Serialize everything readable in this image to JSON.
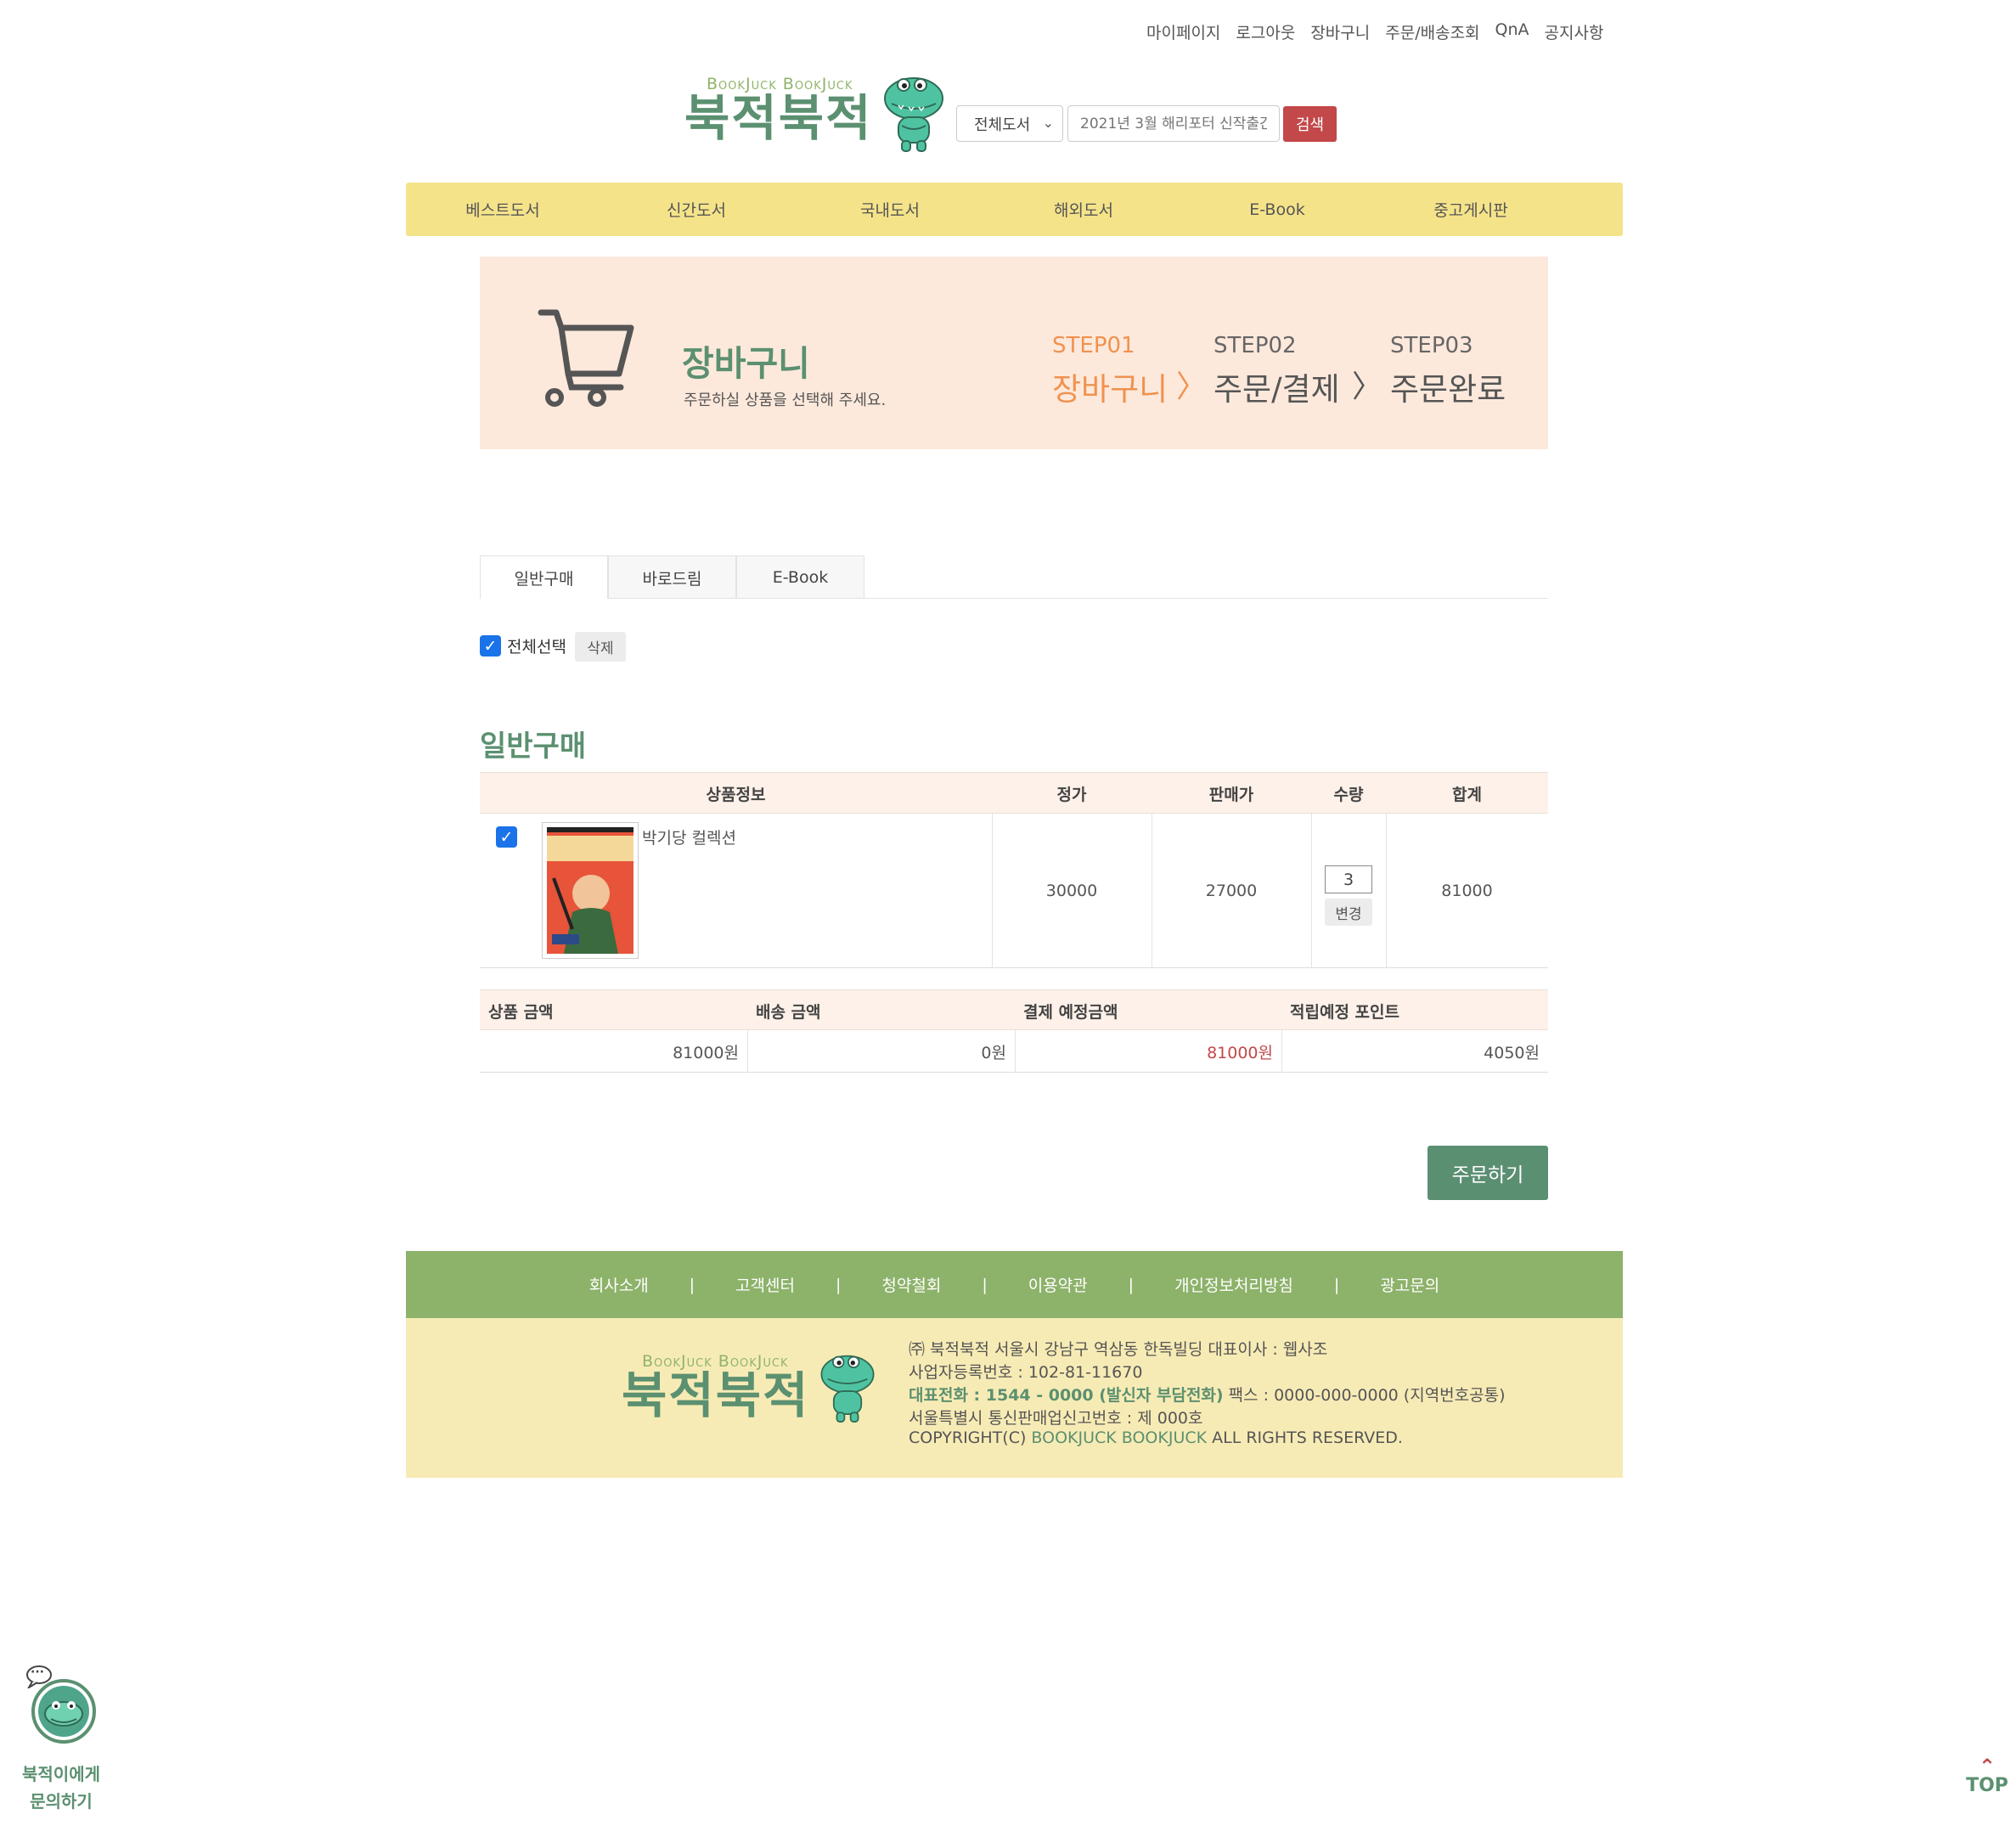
{
  "top_links": [
    "마이페이지",
    "로그아웃",
    "장바구니",
    "주문/배송조회",
    "QnA",
    "공지사항"
  ],
  "logo": {
    "sub": "BookJuck BookJuck",
    "main": "북적북적"
  },
  "search": {
    "category": "전체도서",
    "placeholder": "2021년 3월 해리포터 신작출간!",
    "button": "검색"
  },
  "nav": [
    "베스트도서",
    "신간도서",
    "국내도서",
    "해외도서",
    "E-Book",
    "중고게시판"
  ],
  "banner": {
    "title": "장바구니",
    "subtitle": "주문하실 상품을 선택해 주세요.",
    "steps": [
      {
        "num": "STEP01",
        "name": "장바구니",
        "active": true
      },
      {
        "num": "STEP02",
        "name": "주문/결제",
        "active": false
      },
      {
        "num": "STEP03",
        "name": "주문완료",
        "active": false
      }
    ],
    "arrow": "〉"
  },
  "tabs": [
    "일반구매",
    "바로드림",
    "E-Book"
  ],
  "select_all": {
    "label": "전체선택",
    "delete": "삭제"
  },
  "section_title": "일반구매",
  "cart": {
    "headers": [
      "상품정보",
      "정가",
      "판매가",
      "수량",
      "합계"
    ],
    "items": [
      {
        "title": "박기당 컬렉션",
        "list_price": "30000",
        "sale_price": "27000",
        "qty": "3",
        "change": "변경",
        "total": "81000",
        "cover_text": "박기당 컬렉션"
      }
    ]
  },
  "summary": {
    "headers": [
      "상품 금액",
      "배송 금액",
      "결제 예정금액",
      "적립예정 포인트"
    ],
    "values": [
      "81000원",
      "0원",
      "81000원",
      "4050원"
    ]
  },
  "order_button": "주문하기",
  "footer": {
    "links": [
      "회사소개",
      "고객센터",
      "청약철회",
      "이용약관",
      "개인정보처리방침",
      "광고문의"
    ],
    "separator": "|",
    "company": "㈜ 북적북적   서울시 강남구 역삼동 한독빌딩   대표이사 : 웹사조",
    "biz_no": "사업자등록번호 : 102-81-11670",
    "phone": "대표전화 : 1544 - 0000 (발신자 부담전화)",
    "fax": "   팩스 : 0000-000-0000 (지역번호공통)",
    "mail_order": "서울특별시 통신판매업신고번호 : 제 000호",
    "copyright_pre": "COPYRIGHT(C) ",
    "copyright_brand": "BOOKJUCK BOOKJUCK",
    "copyright_post": " ALL RIGHTS RESERVED."
  },
  "chat": {
    "line1": "북적이에게",
    "line2": "문의하기",
    "bubble": "···"
  },
  "top_button": "TOP",
  "colors": {
    "accent_green": "#5b9070",
    "nav_yellow": "#f5e38a",
    "banner_peach": "#fde9dc",
    "search_red": "#c24849",
    "step_orange": "#f0924f",
    "footer_green": "#8db26a",
    "footer_yellow": "#f7ebb5"
  },
  "icons": [
    "cart-icon",
    "crocodile-mascot-icon",
    "chevron-down-icon",
    "checkbox-icon",
    "chevron-up-icon",
    "chat-bubble-icon"
  ]
}
